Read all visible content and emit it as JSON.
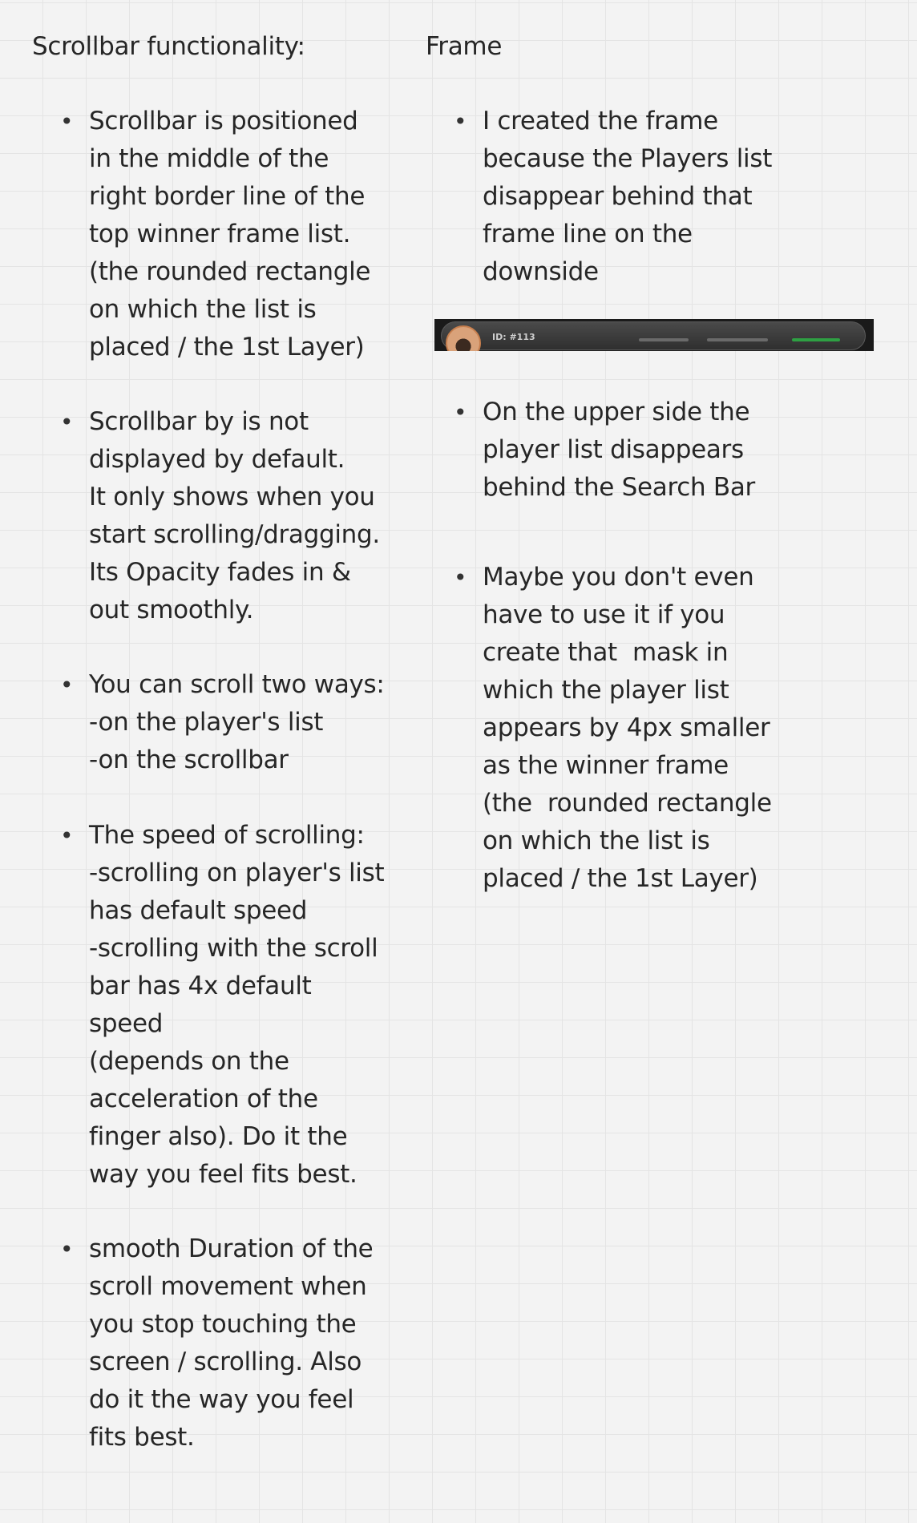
{
  "left": {
    "heading": "Scrollbar functionality:",
    "bullets": [
      "Scrollbar is positioned\nin the middle of the\nright border line of the\ntop winner frame list.\n(the rounded rectangle\non which the list is\nplaced / the 1st Layer)",
      "Scrollbar by is not\ndisplayed by default.\nIt only shows when you\nstart scrolling/dragging.\nIts Opacity fades in &\nout smoothly.",
      "You can scroll two ways:\n-on the player's list\n-on the scrollbar",
      "The speed of scrolling:\n-scrolling on player's list\nhas default speed\n-scrolling with the scroll\nbar has 4x default\nspeed\n(depends on the\nacceleration of the\nfinger also). Do it the\nway you feel fits best.",
      "smooth Duration of the\nscroll movement when\nyou stop touching the\nscreen / scrolling. Also\ndo it the way you feel\nfits best."
    ]
  },
  "right": {
    "heading": "Frame",
    "bullets": [
      "I created the frame\nbecause the Players list\ndisappear behind that\nframe line on the\ndownside",
      "On the upper side the\nplayer list disappears\nbehind the Search Bar",
      "Maybe you don't even\nhave to use it if you\ncreate that  mask in\nwhich the player list\nappears by 4px smaller\nas the winner frame\n(the  rounded rectangle\non which the list is\nplaced / the 1st Layer)"
    ],
    "screenshot": {
      "id_label": "ID: #113"
    }
  },
  "bullet_glyph": "•"
}
